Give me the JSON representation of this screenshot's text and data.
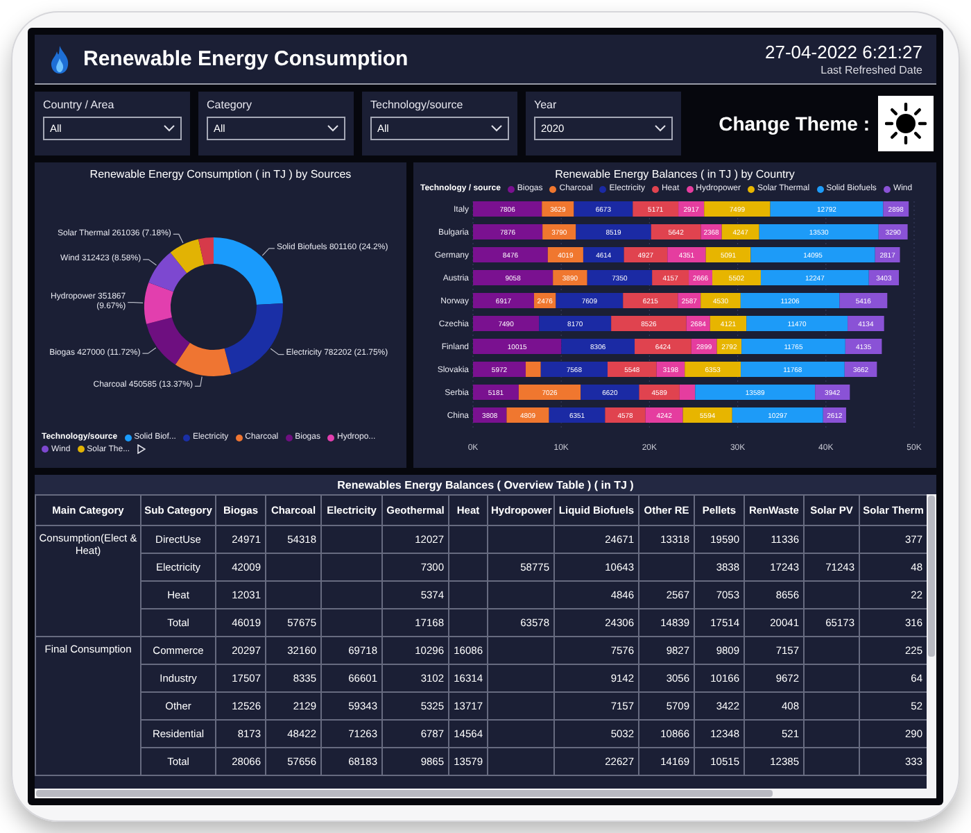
{
  "header": {
    "title": "Renewable Energy Consumption",
    "refreshed_at": "27-04-2022 6:21:27",
    "refreshed_label": "Last Refreshed Date"
  },
  "filters": [
    {
      "label": "Country / Area",
      "value": "All"
    },
    {
      "label": "Category",
      "value": "All"
    },
    {
      "label": "Technology/source",
      "value": "All"
    },
    {
      "label": "Year",
      "value": "2020"
    }
  ],
  "theme_switch": {
    "label": "Change Theme :"
  },
  "donut_chart": {
    "title": "Renewable Energy Consumption ( in TJ ) by Sources",
    "chart_data": {
      "type": "donut",
      "values": [
        24.2,
        21.75,
        13.37,
        11.72,
        9.67,
        8.58,
        7.18,
        3.53
      ],
      "colors": [
        "#1a9bfc",
        "#1a2fa6",
        "#ef7532",
        "#6e0f80",
        "#e23fae",
        "#7d48d0",
        "#e2b304",
        "#d63a4a"
      ],
      "value_labels": [
        "Solid Biofuels 801160 (24.2%)",
        "Electricity 782202 (21.75%)",
        "Charcoal 450585 (13.37%)",
        "Biogas 427000 (11.72%)",
        "Hydropower 351867 (9.67%)",
        "Wind 312423 (8.58%)",
        "Solar Thermal 261036 (7.18%)",
        null
      ]
    },
    "legend": {
      "title": "Technology/source",
      "items": [
        {
          "label": "Solid Biof...",
          "color": "#1a9bfc"
        },
        {
          "label": "Electricity",
          "color": "#1a2fa6"
        },
        {
          "label": "Charcoal",
          "color": "#ef7532"
        },
        {
          "label": "Biogas",
          "color": "#6e0f80"
        },
        {
          "label": "Hydropo...",
          "color": "#e23fae"
        },
        {
          "label": "Wind",
          "color": "#7d48d0"
        },
        {
          "label": "Solar The...",
          "color": "#e2b304"
        }
      ]
    }
  },
  "bar_chart": {
    "title": "Renewable Energy Balances ( in TJ ) by Country",
    "legend_title": "Technology / source",
    "chart_data": {
      "type": "bar",
      "orientation": "horizontal",
      "stacked": true,
      "grid": true,
      "categories": [
        "Italy",
        "Bulgaria",
        "Germany",
        "Austria",
        "Norway",
        "Czechia",
        "Finland",
        "Slovakia",
        "Serbia",
        "China"
      ],
      "series": [
        {
          "name": "Biogas",
          "color": "#7a1190",
          "values": [
            7806,
            7876,
            8476,
            9058,
            6917,
            7490,
            10015,
            5972,
            5181,
            3808
          ]
        },
        {
          "name": "Charcoal",
          "color": "#f0772f",
          "values": [
            3629,
            3790,
            4019,
            3890,
            2476,
            null,
            null,
            1712,
            7026,
            4809
          ]
        },
        {
          "name": "Electricity",
          "color": "#1b2aa4",
          "values": [
            6673,
            8519,
            4614,
            7350,
            7609,
            8170,
            8306,
            7568,
            6620,
            6351
          ]
        },
        {
          "name": "Heat",
          "color": "#e0434f",
          "values": [
            5171,
            5642,
            4927,
            4157,
            6215,
            8526,
            6424,
            5548,
            4589,
            4578
          ]
        },
        {
          "name": "Hydropower",
          "color": "#e53d9f",
          "values": [
            2917,
            2368,
            4351,
            2666,
            2587,
            2684,
            2899,
            3198,
            1765,
            4242
          ]
        },
        {
          "name": "Solar Thermal",
          "color": "#e7b500",
          "values": [
            7499,
            4247,
            5091,
            5502,
            4530,
            4121,
            2792,
            6353,
            null,
            5594
          ]
        },
        {
          "name": "Solid Biofuels",
          "color": "#1d9bf8",
          "values": [
            12792,
            13530,
            14095,
            12247,
            11206,
            11470,
            11765,
            11768,
            13589,
            10297
          ]
        },
        {
          "name": "Wind",
          "color": "#8a52d6",
          "values": [
            2898,
            3290,
            2817,
            3403,
            5416,
            4134,
            4135,
            3662,
            3942,
            2612
          ]
        }
      ],
      "value_labels": [
        [
          "7806",
          "7876",
          "8476",
          "9058",
          "6917",
          "7490",
          "10015",
          "5972",
          "5181",
          "3808"
        ],
        [
          "3629",
          "3790",
          "4019",
          "3890",
          "2476",
          null,
          null,
          null,
          "7026",
          "4809"
        ],
        [
          "6673",
          "8519",
          "4614",
          "7350",
          "7609",
          "8170",
          "8306",
          "7568",
          "6620",
          "6351"
        ],
        [
          "5171",
          "5642",
          "4927",
          "4157",
          "6215",
          "8526",
          "6424",
          "5548",
          "4589",
          "4578"
        ],
        [
          "2917",
          "2368",
          "4351",
          "2666",
          "2587",
          "2684",
          "2899",
          "3198",
          null,
          "4242"
        ],
        [
          "7499",
          "4247",
          "5091",
          "5502",
          "4530",
          "4121",
          "2792",
          "6353",
          null,
          "5594"
        ],
        [
          "12792",
          "13530",
          "14095",
          "12247",
          "11206",
          "11470",
          "11765",
          "11768",
          "13589",
          "10297"
        ],
        [
          "2898",
          "3290",
          "2817",
          "3403",
          "5416",
          "4134",
          "4135",
          "3662",
          "3942",
          "2612"
        ]
      ],
      "xlim": [
        0,
        50000
      ],
      "xticks": [
        {
          "value": 0,
          "label": "0K"
        },
        {
          "value": 10000,
          "label": "10K"
        },
        {
          "value": 20000,
          "label": "20K"
        },
        {
          "value": 30000,
          "label": "30K"
        },
        {
          "value": 40000,
          "label": "40K"
        },
        {
          "value": 50000,
          "label": "50K"
        }
      ]
    }
  },
  "table": {
    "title": "Renewables Energy Balances ( Overview Table ) ( in TJ )",
    "columns": [
      "Main Category",
      "Sub Category",
      "Biogas",
      "Charcoal",
      "Electricity",
      "Geothermal",
      "Heat",
      "Hydropower",
      "Liquid Biofuels",
      "Other RE",
      "Pellets",
      "RenWaste",
      "Solar PV",
      "Solar Therm"
    ],
    "groups": [
      {
        "main_category": "Consumption(Elect & Heat)",
        "rows": [
          {
            "sub_category": "DirectUse",
            "biogas": "24971",
            "charcoal": "54318",
            "geothermal": "12027",
            "liquid_biofuels": "24671",
            "other_re": "13318",
            "pellets": "19590",
            "renwaste": "11336",
            "solar_therm": "377"
          },
          {
            "sub_category": "Electricity",
            "biogas": "42009",
            "geothermal": "7300",
            "hydropower": "58775",
            "liquid_biofuels": "10643",
            "pellets": "3838",
            "renwaste": "17243",
            "solar_pv": "71243",
            "solar_therm": "48"
          },
          {
            "sub_category": "Heat",
            "biogas": "12031",
            "geothermal": "5374",
            "liquid_biofuels": "4846",
            "other_re": "2567",
            "pellets": "7053",
            "renwaste": "8656",
            "solar_therm": "22"
          },
          {
            "sub_category": "Total",
            "biogas": "46019",
            "charcoal": "57675",
            "geothermal": "17168",
            "hydropower": "63578",
            "liquid_biofuels": "24306",
            "other_re": "14839",
            "pellets": "17514",
            "renwaste": "20041",
            "solar_pv": "65173",
            "solar_therm": "316"
          }
        ]
      },
      {
        "main_category": "Final Consumption",
        "rows": [
          {
            "sub_category": "Commerce",
            "biogas": "20297",
            "charcoal": "32160",
            "electricity": "69718",
            "geothermal": "10296",
            "heat": "16086",
            "liquid_biofuels": "7576",
            "other_re": "9827",
            "pellets": "9809",
            "renwaste": "7157",
            "solar_therm": "225"
          },
          {
            "sub_category": "Industry",
            "biogas": "17507",
            "charcoal": "8335",
            "electricity": "66601",
            "geothermal": "3102",
            "heat": "16314",
            "liquid_biofuels": "9142",
            "other_re": "3056",
            "pellets": "10166",
            "renwaste": "9672",
            "solar_therm": "64"
          },
          {
            "sub_category": "Other",
            "biogas": "12526",
            "charcoal": "2129",
            "electricity": "59343",
            "geothermal": "5325",
            "heat": "13717",
            "liquid_biofuels": "7157",
            "other_re": "5709",
            "pellets": "3422",
            "renwaste": "408",
            "solar_therm": "52"
          },
          {
            "sub_category": "Residential",
            "biogas": "8173",
            "charcoal": "48422",
            "electricity": "71263",
            "geothermal": "6787",
            "heat": "14564",
            "liquid_biofuels": "5032",
            "other_re": "10866",
            "pellets": "12348",
            "renwaste": "521",
            "solar_therm": "290"
          },
          {
            "sub_category": "Total",
            "biogas": "28066",
            "charcoal": "57656",
            "electricity": "68183",
            "geothermal": "9865",
            "heat": "13579",
            "liquid_biofuels": "22627",
            "other_re": "14169",
            "pellets": "10515",
            "renwaste": "12385",
            "solar_therm": "333"
          }
        ]
      }
    ]
  }
}
